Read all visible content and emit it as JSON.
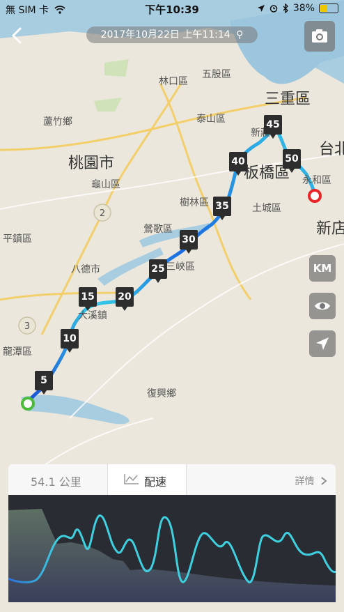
{
  "status_bar": {
    "carrier": "無 SIM 卡",
    "time": "下午10:39",
    "battery": "38%"
  },
  "header": {
    "date_time": "2017年10月22日 上午11:14"
  },
  "map": {
    "labels": [
      {
        "text": "林口區"
      },
      {
        "text": "五股區"
      },
      {
        "text": "三重區"
      },
      {
        "text": "蘆竹鄉"
      },
      {
        "text": "泰山區"
      },
      {
        "text": "新莊"
      },
      {
        "text": "台北"
      },
      {
        "text": "桃園市"
      },
      {
        "text": "板橋區"
      },
      {
        "text": "永和區"
      },
      {
        "text": "龜山區"
      },
      {
        "text": "樹林區"
      },
      {
        "text": "土城區"
      },
      {
        "text": "新店"
      },
      {
        "text": "平鎮區"
      },
      {
        "text": "鶯歌區"
      },
      {
        "text": "八德市"
      },
      {
        "text": "三峽區"
      },
      {
        "text": "大溪鎮"
      },
      {
        "text": "龍潭區"
      },
      {
        "text": "復興鄉"
      }
    ],
    "km_markers": [
      "5",
      "10",
      "15",
      "20",
      "25",
      "30",
      "35",
      "40",
      "45",
      "50"
    ],
    "route_colors": {
      "slow": "#1a4fd6",
      "fast": "#35c9e6"
    },
    "start_color": "#4cbb3a",
    "end_color": "#e8262a"
  },
  "controls": {
    "unit_label": "KM"
  },
  "panel": {
    "distance_tab": "54.1 公里",
    "pace_tab": "配速",
    "detail_link": "詳情"
  }
}
